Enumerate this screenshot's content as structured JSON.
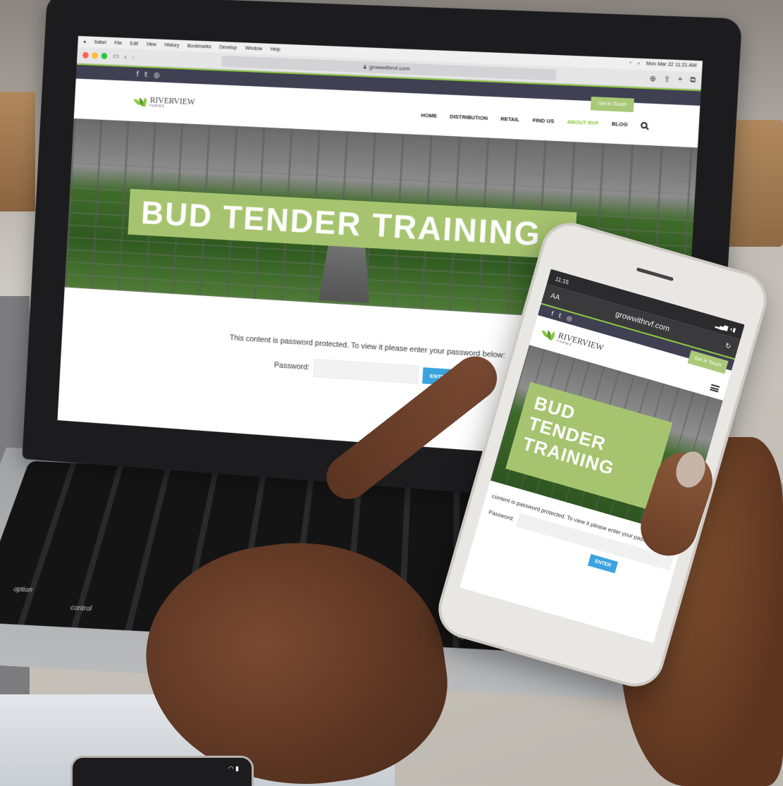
{
  "mac_menubar": {
    "apple": "",
    "items": [
      "Safari",
      "File",
      "Edit",
      "View",
      "History",
      "Bookmarks",
      "Develop",
      "Window",
      "Help"
    ],
    "clock": "Mon Mar 22  11:21 AM"
  },
  "browser": {
    "url": "growwithrvf.com"
  },
  "site": {
    "social": [
      "f",
      "𝕥",
      "◎"
    ],
    "logo_main": "RIVERVIEW",
    "logo_sub": "FARMS",
    "cta": "Get in Touch",
    "nav": [
      "HOME",
      "DISTRIBUTION",
      "RETAIL",
      "FIND US",
      "ABOUT RVF",
      "BLOG"
    ],
    "nav_active": "ABOUT RVF",
    "hero_title": "BUD TENDER TRAINING",
    "protected_message": "This content is password protected. To view it please enter your password below:",
    "password_label": "Password:",
    "enter_label": "ENTER"
  },
  "phone": {
    "time": "11:15",
    "text_size": "AA",
    "url": "growwithrvf.com",
    "hero_lines": [
      "BUD",
      "TENDER",
      "TRAINING"
    ],
    "protected_message": "content is password protected. To view it please enter your password below:",
    "password_label": "Password:",
    "enter_label": "ENTER"
  },
  "keyboard": {
    "labels": [
      "option",
      "control",
      "option"
    ]
  },
  "colors": {
    "brand_green": "#8cc63f",
    "band_green": "#a6c46f",
    "topbar_navy": "#3f4052",
    "enter_blue": "#3aa3e0"
  }
}
